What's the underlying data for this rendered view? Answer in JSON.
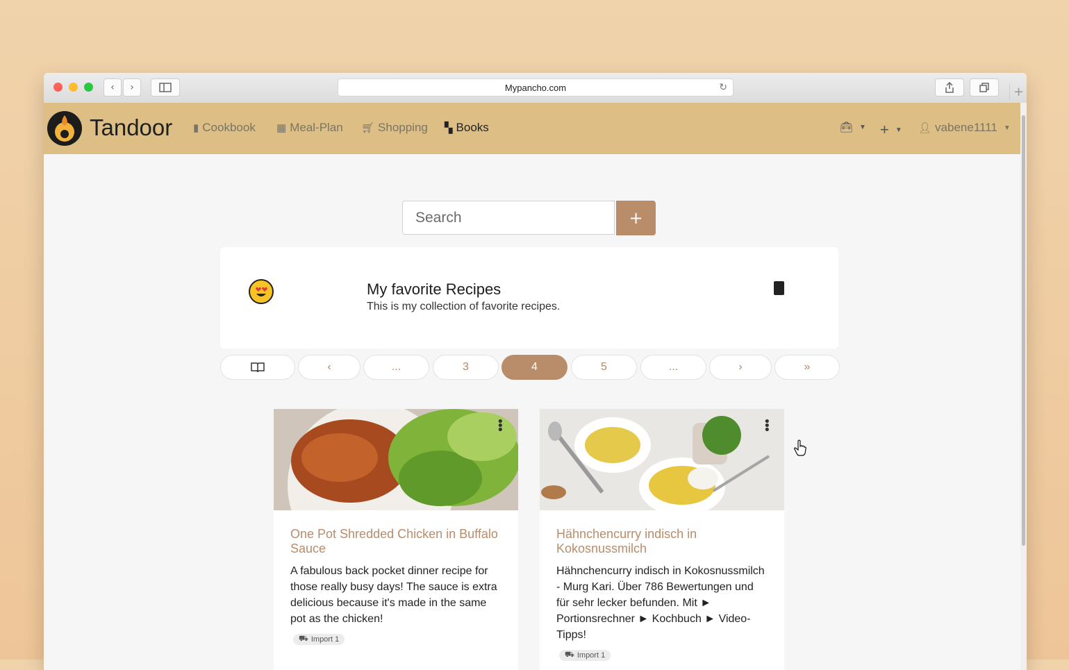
{
  "browser": {
    "url": "Mypancho.com"
  },
  "navbar": {
    "brand": "Tandoor",
    "links": [
      {
        "label": "Cookbook",
        "icon": "book-icon"
      },
      {
        "label": "Meal-Plan",
        "icon": "calendar-icon"
      },
      {
        "label": "Shopping",
        "icon": "cart-icon"
      },
      {
        "label": "Books",
        "icon": "open-book-icon"
      }
    ],
    "user": "vabene1111"
  },
  "search": {
    "placeholder": "Search",
    "add_label": "+"
  },
  "book": {
    "title": "My favorite Recipes",
    "description": "This is my collection of favorite recipes."
  },
  "pagination": {
    "items": [
      "‹",
      "...",
      "3",
      "4",
      "5",
      "...",
      "›",
      "»"
    ],
    "active": "4"
  },
  "recipes": [
    {
      "title": "One Pot Shredded Chicken in Buffalo Sauce",
      "description": "A fabulous back pocket dinner recipe for those really busy days! The sauce is extra delicious because it's made in the same pot as the chicken!",
      "badge": "Import 1"
    },
    {
      "title": "Hähnchencurry indisch in Kokosnussmilch",
      "description": "Hähnchencurry indisch in Kokosnussmilch - Murg Kari. Über 786 Bewertungen und für sehr lecker befunden. Mit ► Portionsrechner ► Kochbuch ► Video-Tipps!",
      "badge": "Import 1"
    }
  ],
  "colors": {
    "navbar": "#ddbf86",
    "accent": "#b98c6a"
  }
}
